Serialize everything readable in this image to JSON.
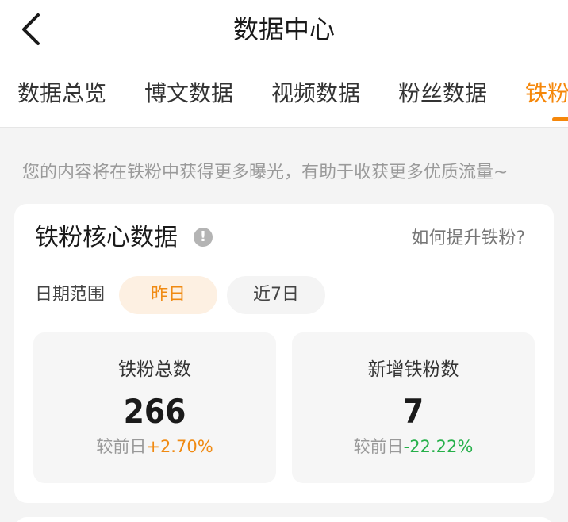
{
  "header": {
    "back_icon": "chevron-left-icon",
    "title": "数据中心"
  },
  "tabs": [
    {
      "label": "数据总览"
    },
    {
      "label": "博文数据"
    },
    {
      "label": "视频数据"
    },
    {
      "label": "粉丝数据"
    },
    {
      "label": "铁粉"
    }
  ],
  "active_tab": "铁粉",
  "tip": "您的内容将在铁粉中获得更多曝光，有助于收获更多优质流量~",
  "core": {
    "title": "铁粉核心数据",
    "info_icon": "info-icon",
    "how_link": "如何提升铁粉?",
    "range_label": "日期范围",
    "range_options": [
      "昨日",
      "近7日"
    ],
    "range_selected": "昨日",
    "stats": [
      {
        "label": "铁粉总数",
        "value": "266",
        "compare_prefix": "较前日",
        "change": "+2.70%"
      },
      {
        "label": "新增铁粉数",
        "value": "7",
        "compare_prefix": "较前日",
        "change": "-22.22%"
      }
    ]
  },
  "colors": {
    "accent": "#f5870a",
    "increase": "#f08a12",
    "decrease": "#26b04a",
    "background": "#f4f4f4"
  }
}
